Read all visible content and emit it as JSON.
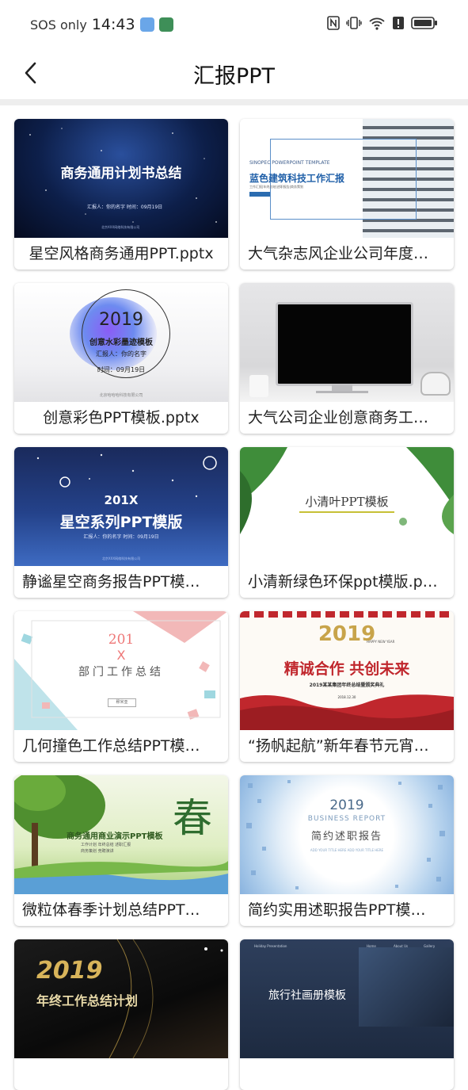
{
  "status": {
    "network": "SOS only",
    "time": "14:43"
  },
  "header": {
    "title": "汇报PPT"
  },
  "colors": {
    "accent_blue": "#2b6cb0",
    "red": "#c0272d",
    "green": "#3f8d3a",
    "navy": "#0e2a5a"
  },
  "templates": [
    {
      "caption": "星空风格商务通用PPT.pptx",
      "thumb": {
        "title": "商务通用计划书总结",
        "sub": "汇报人：你的名字  时间：09月19日",
        "foot": "北京XXX网络科技有限公司"
      }
    },
    {
      "caption": "大气杂志风企业公司年度…",
      "thumb": {
        "title": "蓝色建筑科技工作汇报",
        "sub": "SINOPEC POWERPOINT TEMPLATE",
        "foot": "工作汇报|年终总结|述职报告|商务策划"
      }
    },
    {
      "caption": "创意彩色PPT模板.pptx",
      "thumb": {
        "title": "2019",
        "sub": "创意水彩墨迹模板",
        "line1": "汇报人：你的名字",
        "line2": "时间：09月19日",
        "foot": "北京哈哈哈科技有限公司"
      }
    },
    {
      "caption": "大气公司企业创意商务工…",
      "thumb": {}
    },
    {
      "caption": "静谧星空商务报告PPT模…",
      "thumb": {
        "title": "201X",
        "sub": "星空系列PPT模版",
        "line1": "汇报人：你的名字  时间：09月19日",
        "foot": "北京XXX网络科技有限公司"
      }
    },
    {
      "caption": "小清新绿色环保ppt模版.p…",
      "thumb": {
        "title": "小清叶PPT模板"
      }
    },
    {
      "caption": "几何撞色工作总结PPT模…",
      "thumb": {
        "title": "201",
        "mark": "X",
        "sub": "部门工作总结",
        "foot": "穆米亚"
      }
    },
    {
      "caption": "“扬帆起航”新年春节元宵…",
      "thumb": {
        "title": "2019",
        "sub": "HAPPY NEW YEAR",
        "line1": "精诚合作 共创未来",
        "line2": "2019某某集团年终总结暨颁奖典礼",
        "foot": "2018.12.30"
      }
    },
    {
      "caption": "微粒体春季计划总结PPT…",
      "thumb": {
        "title": "商务通用商业演示PPT模板",
        "sub": "工作计划 年终总结 述职汇报",
        "line1": "商务策划 竞聘演讲",
        "mark": "春"
      }
    },
    {
      "caption": "简约实用述职报告PPT模…",
      "thumb": {
        "title": "2019",
        "sub": "BUSINESS REPORT",
        "line1": "简约述职报告",
        "foot": "ADD YOUR TITLE HERE ADD YOUR TITLE HERE"
      }
    },
    {
      "caption": "",
      "thumb": {
        "title": "2019",
        "sub": "年终工作总结计划"
      }
    },
    {
      "caption": "",
      "thumb": {
        "title": "旅行社画册模板",
        "sub": "Holiday Presentation",
        "nav1": "Home",
        "nav2": "About Us",
        "nav3": "Gallery"
      }
    }
  ]
}
